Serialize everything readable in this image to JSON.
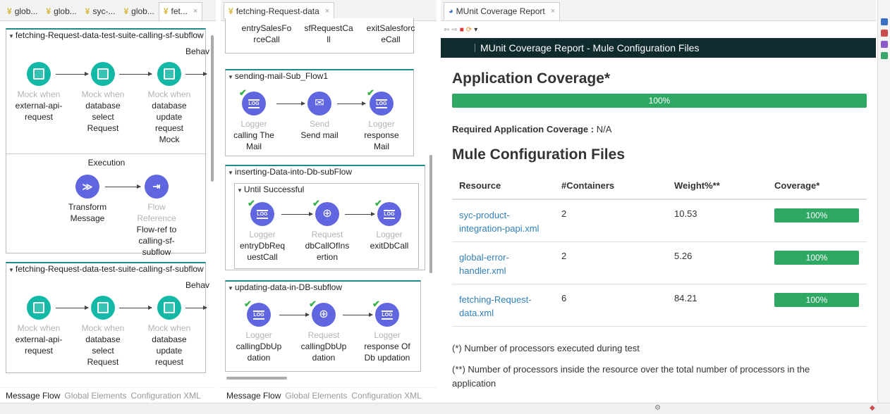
{
  "p1": {
    "tabs": [
      {
        "label": "glob...",
        "active": false
      },
      {
        "label": "glob...",
        "active": false
      },
      {
        "label": "syc-...",
        "active": false
      },
      {
        "label": "glob...",
        "active": false
      },
      {
        "label": "fet...",
        "active": true
      }
    ],
    "flow1": {
      "title": "fetching-Request-data-test-suite-calling-sf-subflow",
      "section_behavior": "Behav",
      "section_execution": "Execution",
      "behavior_nodes": [
        {
          "kind": "Mock when",
          "name": "external-api-request"
        },
        {
          "kind": "Mock when",
          "name": "database select Request"
        },
        {
          "kind": "Mock when",
          "name": "database update request Mock"
        }
      ],
      "execution_nodes": [
        {
          "kind": "",
          "name": "Transform Message"
        },
        {
          "kind": "Flow Reference",
          "name": "Flow-ref to calling-sf-subflow"
        }
      ]
    },
    "flow2": {
      "title": "fetching-Request-data-test-suite-calling-sf-subflow",
      "section_behavior": "Behav",
      "behavior_nodes": [
        {
          "kind": "Mock when",
          "name": "external-api-request"
        },
        {
          "kind": "Mock when",
          "name": "database select Request"
        },
        {
          "kind": "Mock when",
          "name": "database update request"
        }
      ]
    },
    "bottom_tabs": [
      "Message Flow",
      "Global Elements",
      "Configuration XML"
    ]
  },
  "p2": {
    "tab": "fetching-Request-data",
    "top_partial": [
      "entrySalesFo rceCall",
      "sfRequestCa ll",
      "exitSalesforc eCall"
    ],
    "flows": [
      {
        "title": "sending-mail-Sub_Flow1",
        "nodes": [
          {
            "kind": "Logger",
            "name": "calling The Mail"
          },
          {
            "kind": "Send",
            "name": "Send mail"
          },
          {
            "kind": "Logger",
            "name": "response Mail"
          }
        ]
      },
      {
        "title": "inserting-Data-into-Db-subFlow",
        "scope": "Until Successful",
        "nodes": [
          {
            "kind": "Logger",
            "name": "entryDbReq uestCall"
          },
          {
            "kind": "Request",
            "name": "dbCallOfIns ertion"
          },
          {
            "kind": "Logger",
            "name": "exitDbCall"
          }
        ]
      },
      {
        "title": "updating-data-in-DB-subflow",
        "nodes": [
          {
            "kind": "Logger",
            "name": "callingDbUp dation"
          },
          {
            "kind": "Request",
            "name": "callingDbUp dation"
          },
          {
            "kind": "Logger",
            "name": "response Of Db updation"
          }
        ]
      }
    ],
    "bottom_tabs": [
      "Message Flow",
      "Global Elements",
      "Configuration XML"
    ]
  },
  "p3": {
    "tab": "MUnit Coverage Report",
    "header": "MUnit Coverage Report - Mule Configuration Files",
    "app_title": "Application Coverage*",
    "app_coverage": "100%",
    "app_coverage_value": 1.0,
    "required_label": "Required Application Coverage :",
    "required_value": "N/A",
    "files_title": "Mule Configuration Files",
    "columns": [
      "Resource",
      "#Containers",
      "Weight%**",
      "Coverage*"
    ],
    "rows": [
      {
        "resource": "syc-product-integration-papi.xml",
        "containers": "2",
        "weight": "10.53",
        "coverage": "100%"
      },
      {
        "resource": "global-error-handler.xml",
        "containers": "2",
        "weight": "5.26",
        "coverage": "100%"
      },
      {
        "resource": "fetching-Request-data.xml",
        "containers": "6",
        "weight": "84.21",
        "coverage": "100%"
      }
    ],
    "note1": "(*) Number of processors executed during test",
    "note2": "(**) Number of processors inside the resource over the total number of processors in the application"
  },
  "colors": {
    "teal": "#14b8a6",
    "purple": "#5f66e0",
    "coverage_green": "#2ea863",
    "report_header": "#0f2b2d"
  }
}
